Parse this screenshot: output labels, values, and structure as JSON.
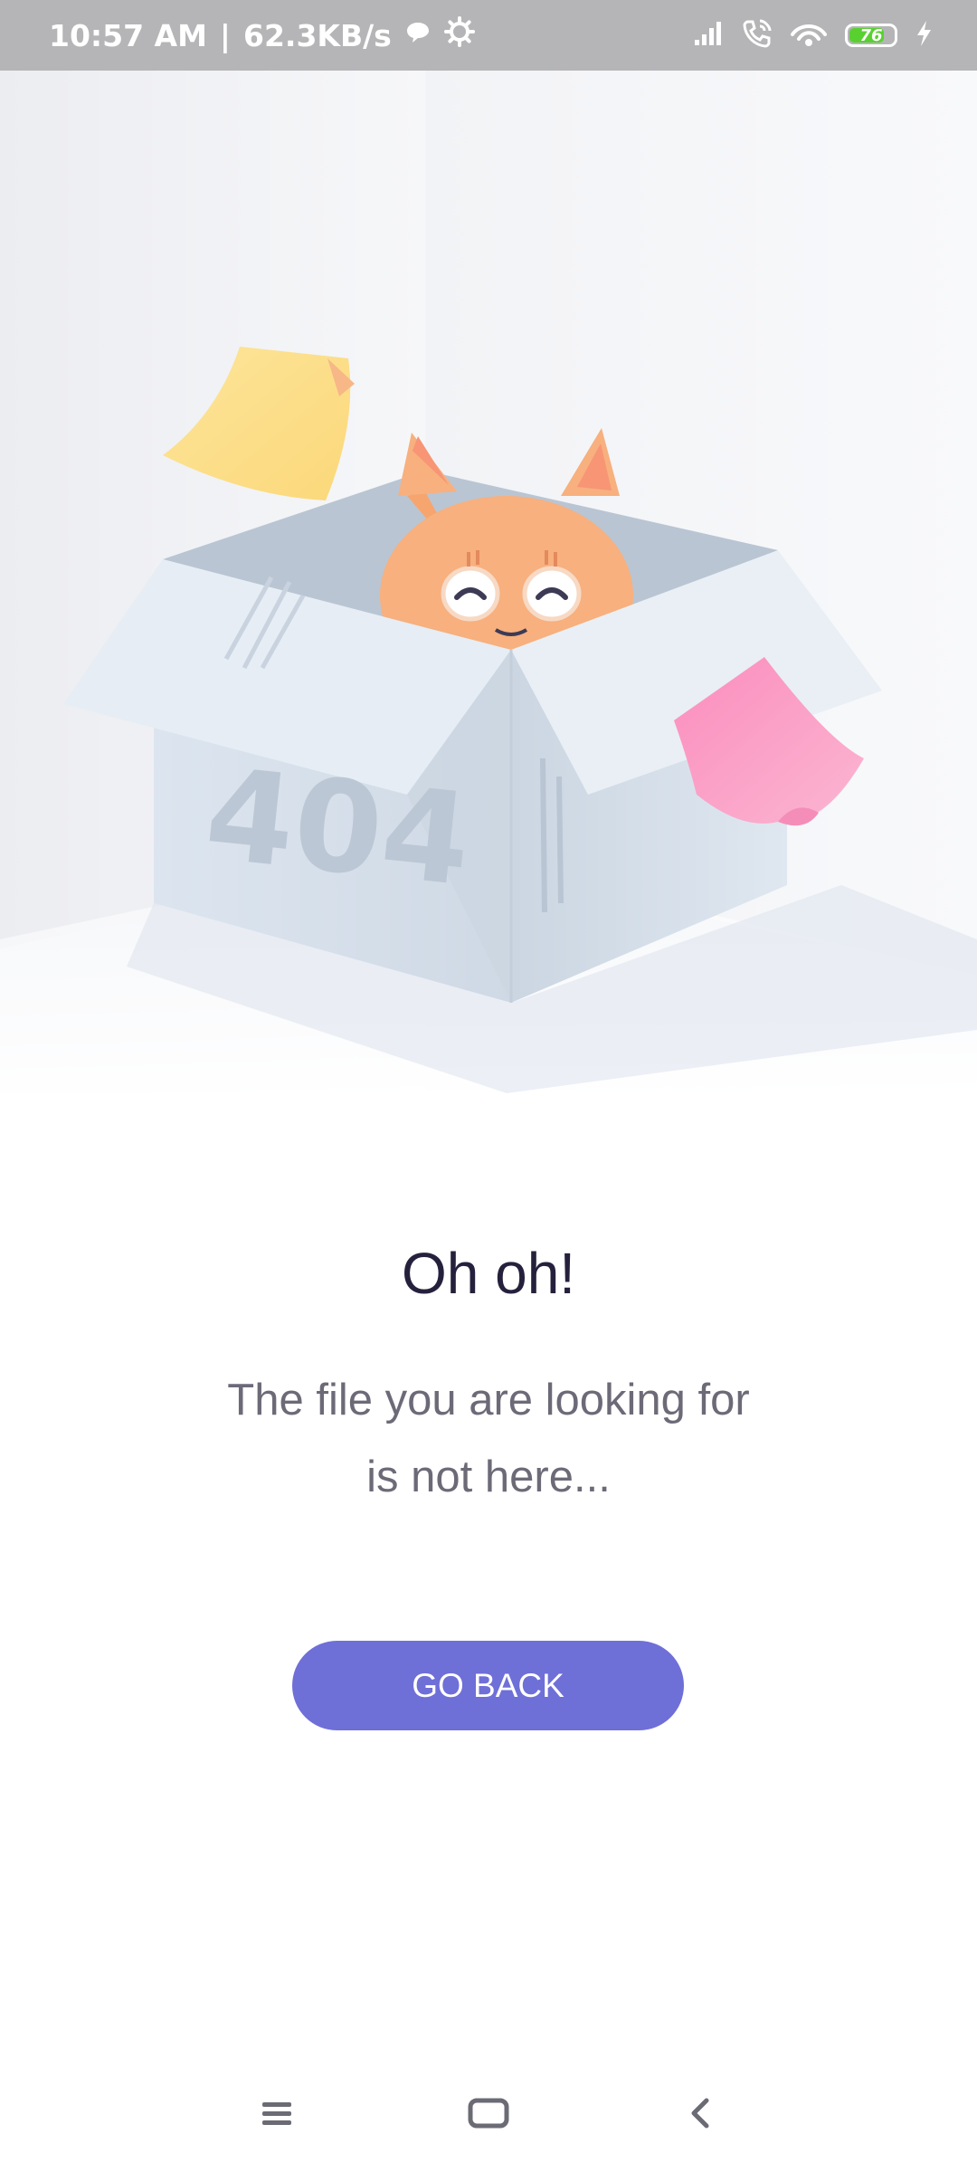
{
  "status_bar": {
    "time": "10:57 AM",
    "separator": "|",
    "speed": "62.3KB/s",
    "battery_level": "76",
    "icons": [
      "chat-bubble-icon",
      "gear-icon",
      "signal-icon",
      "wifi-call-icon",
      "hotspot-icon",
      "battery-icon",
      "charging-icon"
    ]
  },
  "illustration": {
    "box_label": "404"
  },
  "content": {
    "headline": "Oh oh!",
    "message_line1": "The file you are looking for",
    "message_line2": "is not here...",
    "button_label": "GO BACK"
  },
  "nav_bar": {
    "items": [
      "menu-icon",
      "home-icon",
      "back-icon"
    ]
  },
  "colors": {
    "accent": "#6f6fd8",
    "headline": "#25213d",
    "message": "#6d6a78",
    "status_bar": "#b5b5b7",
    "battery_fill": "#58d130",
    "cat": "#f7b07e",
    "note_yellow": "#fde08b",
    "note_pink": "#f9a0c6"
  }
}
